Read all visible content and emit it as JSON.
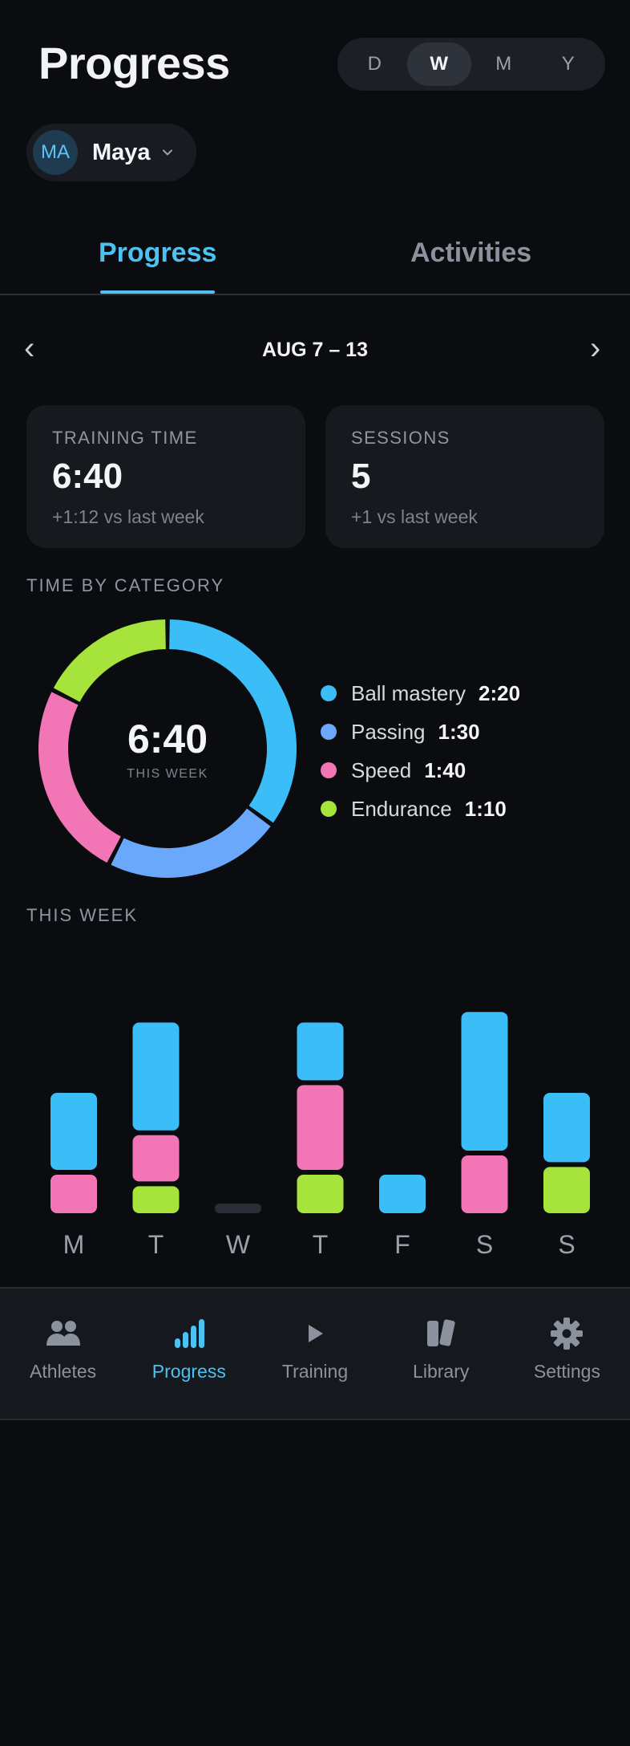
{
  "header": {
    "title": "Progress"
  },
  "range_switch": {
    "options": [
      "D",
      "W",
      "M",
      "Y"
    ],
    "selected": "W"
  },
  "athlete": {
    "initials": "MA",
    "name": "Maya"
  },
  "tabs": [
    {
      "label": "Progress",
      "active": true
    },
    {
      "label": "Activities",
      "active": false
    }
  ],
  "week_nav": {
    "label": "AUG 7 – 13",
    "prev_icon": "chevron-left-icon",
    "next_icon": "chevron-right-icon"
  },
  "stats": {
    "training_time": {
      "label": "TRAINING TIME",
      "value": "6:40",
      "delta": "+1:12 vs last week"
    },
    "sessions": {
      "label": "SESSIONS",
      "value": "5",
      "delta": "+1 vs last week"
    }
  },
  "category_section": {
    "title": "TIME BY CATEGORY",
    "total": "6:40",
    "total_caption": "THIS WEEK",
    "categories": [
      {
        "name": "Ball mastery",
        "value": "2:20",
        "minutes": 140,
        "color": "#3bbef7"
      },
      {
        "name": "Passing",
        "value": "1:30",
        "minutes": 90,
        "color": "#6aa8fb"
      },
      {
        "name": "Speed",
        "value": "1:40",
        "minutes": 100,
        "color": "#f276b6"
      },
      {
        "name": "Endurance",
        "value": "1:10",
        "minutes": 70,
        "color": "#a6e43c"
      }
    ]
  },
  "weekly_section": {
    "title": "THIS WEEK"
  },
  "chart_data": {
    "type": "bar",
    "stacked": true,
    "categories": [
      "M",
      "T",
      "W",
      "T",
      "F",
      "S",
      "S"
    ],
    "series": [
      {
        "name": "Endurance",
        "color": "#a6e43c",
        "values": [
          0,
          14,
          0,
          20,
          0,
          0,
          24
        ]
      },
      {
        "name": "Speed",
        "color": "#f276b6",
        "values": [
          20,
          24,
          0,
          44,
          0,
          30,
          0
        ]
      },
      {
        "name": "Ball mastery",
        "color": "#3bbef7",
        "values": [
          40,
          56,
          0,
          30,
          20,
          72,
          36
        ]
      }
    ]
  },
  "bottom_nav": {
    "items": [
      {
        "label": "Athletes",
        "icon": "users-icon",
        "active": false
      },
      {
        "label": "Progress",
        "icon": "bar-chart-icon",
        "active": true
      },
      {
        "label": "Training",
        "icon": "play-icon",
        "active": false
      },
      {
        "label": "Library",
        "icon": "book-icon",
        "active": false
      },
      {
        "label": "Settings",
        "icon": "gear-icon",
        "active": false
      }
    ]
  }
}
